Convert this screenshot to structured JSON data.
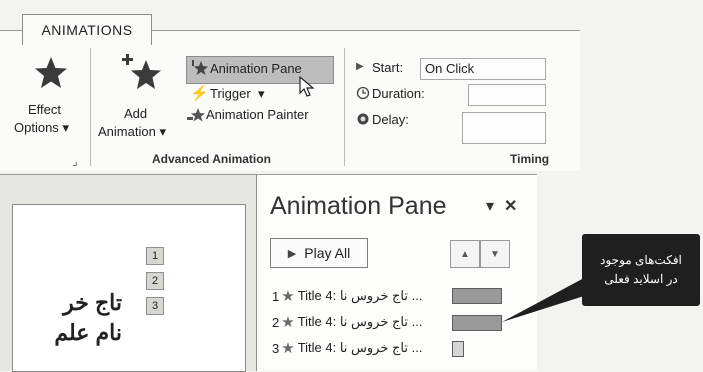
{
  "ribbon": {
    "tab_label": "ANIMATIONS",
    "effect_options": {
      "line1": "Effect",
      "line2": "Options",
      "arrow": "▾"
    },
    "add_animation": {
      "line1": "Add",
      "line2": "Animation",
      "arrow": "▾"
    },
    "animation_pane_btn": "Animation Pane",
    "trigger_btn": "Trigger",
    "trigger_arrow": "▾",
    "animation_painter_btn": "Animation Painter",
    "group_advanced": "Advanced Animation",
    "group_timing": "Timing",
    "start_label": "Start:",
    "start_value": "On Click",
    "duration_label": "Duration:",
    "delay_label": "Delay:"
  },
  "slide": {
    "markers": [
      "1",
      "2",
      "3"
    ],
    "line1": "تاج خر",
    "line2": "نام علم"
  },
  "pane": {
    "title": "Animation Pane",
    "dropdown_glyph": "▾",
    "close_glyph": "✕",
    "play_all": "Play All",
    "items": [
      {
        "num": "1",
        "text": "Title 4: تاج خروس نا ..."
      },
      {
        "num": "2",
        "text": "Title 4: تاج خروس نا ..."
      },
      {
        "num": "3",
        "text": "Title 4: تاج خروس نا ..."
      }
    ]
  },
  "callout": {
    "line1": "افکت‌های موجود",
    "line2": "در اسلاید فعلی"
  },
  "colors": {
    "accent_highlight": "#bdbdbd",
    "callout_bg": "#1f1f1f"
  }
}
